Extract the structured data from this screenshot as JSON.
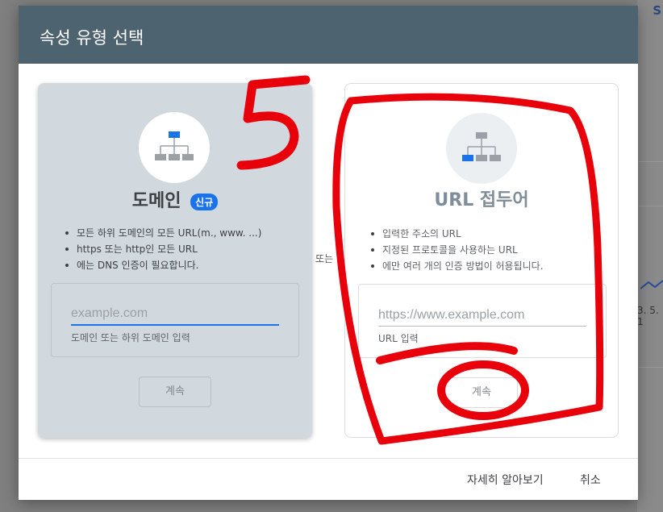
{
  "background": {
    "link_text": "S",
    "axis_text": "3. 5. 1"
  },
  "dialog": {
    "title": "속성 유형 선택",
    "or_label": "또는",
    "domain_card": {
      "icon": "sitemap-icon",
      "title": "도메인",
      "badge": "신규",
      "bullets": [
        "모든 하위 도메인의 모든 URL(m., www. ...)",
        "https 또는 http인 모든 URL",
        "에는 DNS 인증이 필요합니다."
      ],
      "input_placeholder": "example.com",
      "input_value": "",
      "helper_text": "도메인 또는 하위 도메인 입력",
      "continue_label": "계속"
    },
    "url_card": {
      "icon": "sitemap-icon",
      "title": "URL 접두어",
      "bullets": [
        "입력한 주소의 URL",
        "지정된 프로토콜을 사용하는 URL",
        "에만 여러 개의 인증 방법이 허용됩니다."
      ],
      "input_placeholder": "https://www.example.com",
      "input_value": "",
      "helper_text": "URL 입력",
      "continue_label": "계속"
    },
    "annotation": {
      "number": "5",
      "color": "#e8000a"
    },
    "footer": {
      "learn_more_label": "자세히 알아보기",
      "cancel_label": "취소"
    }
  },
  "colors": {
    "header_bg": "#4e6370",
    "accent": "#1a73e8",
    "domain_card_bg": "#d1d9de"
  }
}
